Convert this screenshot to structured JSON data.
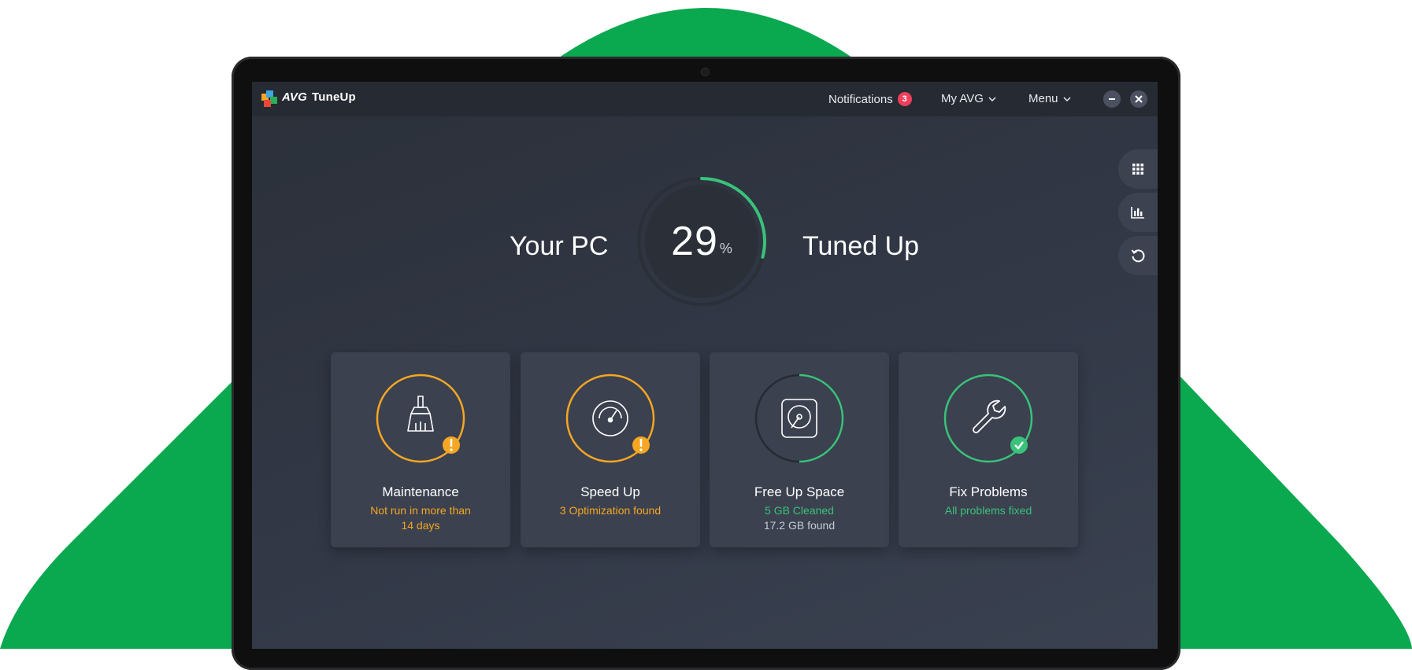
{
  "app": {
    "brand_prefix": "AVG",
    "brand_name": "TuneUp"
  },
  "header": {
    "notifications_label": "Notifications",
    "notifications_count": "3",
    "my_avg_label": "My AVG",
    "menu_label": "Menu"
  },
  "hero": {
    "left_text": "Your PC",
    "right_text": "Tuned Up",
    "percent_value": "29",
    "percent_unit": "%",
    "progress_fraction": 0.29
  },
  "cards": [
    {
      "title": "Maintenance",
      "line1": "Not run in more than",
      "line2": "14 days",
      "status": "warning",
      "icon": "broom-icon"
    },
    {
      "title": "Speed Up",
      "line1": "3 Optimization found",
      "line2": "",
      "status": "warning",
      "icon": "speedometer-icon"
    },
    {
      "title": "Free Up Space",
      "line1": "5 GB Cleaned",
      "line2": "17.2 GB found",
      "status": "partial",
      "icon": "hard-drive-icon"
    },
    {
      "title": "Fix Problems",
      "line1": "All problems fixed",
      "line2": "",
      "status": "ok",
      "icon": "wrench-icon"
    }
  ],
  "side_rail": [
    "apps-grid-icon",
    "bar-chart-icon",
    "undo-icon"
  ],
  "colors": {
    "brand_green": "#0aa84f",
    "warning": "#f5a623",
    "success": "#39c27a",
    "badge": "#ee3f5b",
    "card_bg": "#3b414f"
  }
}
